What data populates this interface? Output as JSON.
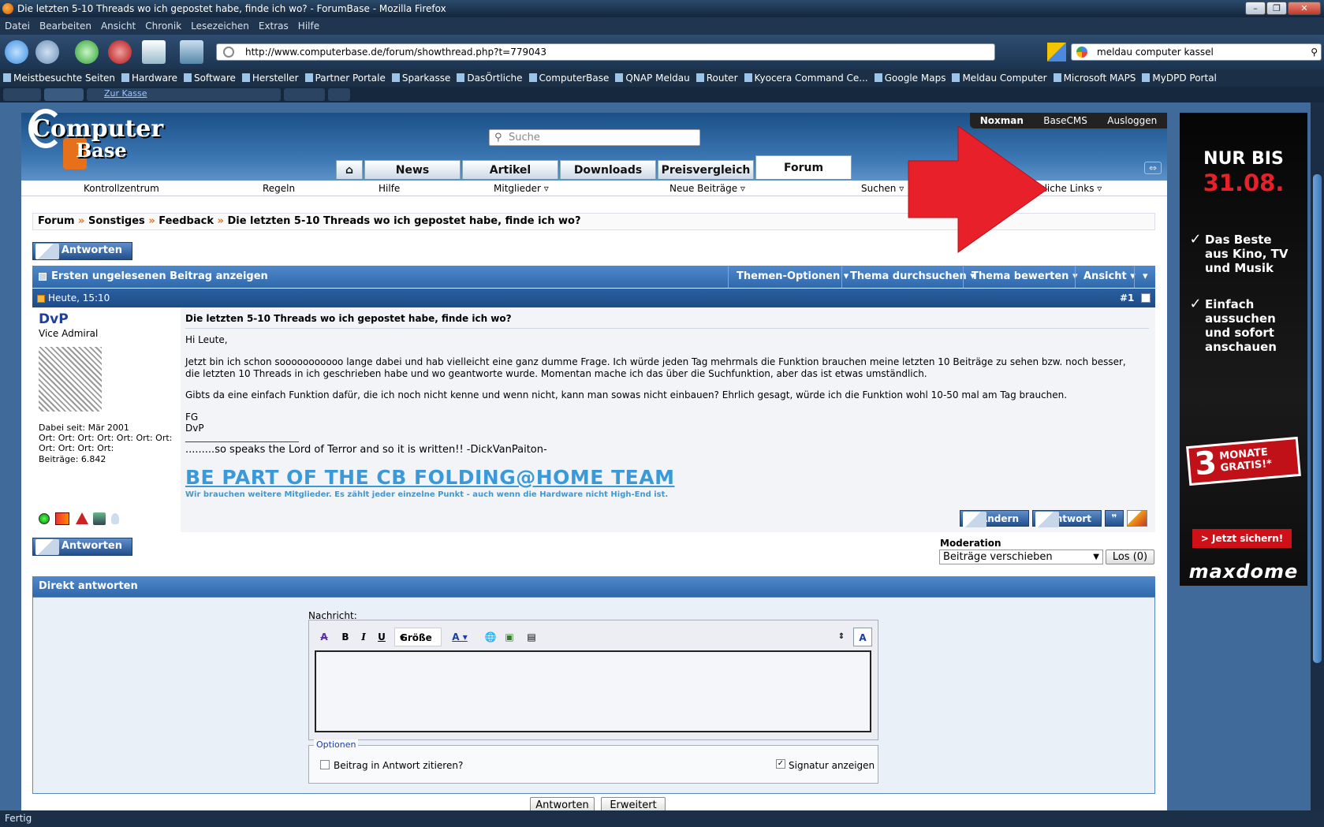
{
  "window": {
    "title": "Die letzten 5-10 Threads wo ich gepostet habe, finde ich wo? - ForumBase - Mozilla Firefox"
  },
  "menu": [
    "Datei",
    "Bearbeiten",
    "Ansicht",
    "Chronik",
    "Lesezeichen",
    "Extras",
    "Hilfe"
  ],
  "url": "http://www.computerbase.de/forum/showthread.php?t=779043",
  "browser_search": "meldau computer kassel",
  "bookmarks": [
    "Meistbesuchte Seiten",
    "Hardware",
    "Software",
    "Hersteller",
    "Partner Portale",
    "Sparkasse",
    "DasÖrtliche",
    "ComputerBase",
    "QNAP Meldau",
    "Router",
    "Kyocera Command Ce...",
    "Google Maps",
    "Meldau Computer",
    "Microsoft MAPS",
    "MyDPD Portal"
  ],
  "tab_link": "Zur Kasse",
  "site": {
    "logo_line1": "Computer",
    "logo_line2": "Base",
    "search_placeholder": "Suche",
    "user": [
      "Noxman",
      "BaseCMS",
      "Ausloggen"
    ],
    "tabs": [
      "News",
      "Artikel",
      "Downloads",
      "Preisvergleich",
      "Forum"
    ],
    "subnav": [
      "Kontrollzentrum",
      "Regeln",
      "Hilfe",
      "Mitglieder ▿",
      "Neue Beiträge ▿",
      "Suchen ▿",
      "Nützliche Links ▿"
    ]
  },
  "breadcrumb": [
    "Forum",
    "Sonstiges",
    "Feedback",
    "Die letzten 5-10 Threads wo ich gepostet habe, finde ich wo?"
  ],
  "breadcrumb_sep": "»",
  "reply_button": "Antworten",
  "threadbar": {
    "first_unread": "Ersten ungelesenen Beitrag anzeigen",
    "options": [
      "Themen-Optionen ▾",
      "Thema durchsuchen ▾",
      "Thema bewerten ▾",
      "Ansicht ▾",
      "▾"
    ]
  },
  "post": {
    "date": "Heute, 15:10",
    "number": "#1",
    "username": "DvP",
    "rank": "Vice Admiral",
    "joined": "Dabei seit: Mär 2001",
    "location": "Ort: Ort: Ort: Ort: Ort: Ort: Ort: Ort: Ort: Ort: Ort:",
    "posts": "Beiträge: 6.842",
    "title": "Die letzten 5-10 Threads wo ich gepostet habe, finde ich wo?",
    "greeting": "Hi Leute,",
    "para1": "Jetzt bin ich schon sooooooooooo lange dabei und hab vielleicht eine ganz dumme Frage. Ich würde jeden Tag mehrmals die Funktion brauchen meine letzten 10 Beiträge zu sehen bzw. noch besser, die letzten 10 Threads in ich geschrieben habe und wo geantworte wurde. Momentan mache ich das über die Suchfunktion, aber das ist etwas umständlich.",
    "para2": "Gibts da eine einfach Funktion dafür, die ich noch nicht kenne und wenn nicht, kann man sowas nicht einbauen? Ehrlich gesagt, würde ich die Funktion wohl 10-50 mal am Tag brauchen.",
    "sign1": "FG",
    "sign2": "DvP",
    "sig_quote": ".........so speaks the Lord of Terror and so it is written!! -DickVanPaiton-",
    "sig_banner": "BE PART OF THE CB FOLDING@HOME TEAM",
    "sig_sub": "Wir brauchen weitere Mitglieder. Es zählt jeder einzelne Punkt - auch wenn die Hardware nicht High-End ist.",
    "btn_edit": "Ändern",
    "btn_reply": "Antwort"
  },
  "moderation": {
    "label": "Moderation",
    "selected": "Beiträge verschieben",
    "go": "Los (0)"
  },
  "quick_reply": {
    "title": "Direkt antworten",
    "message_label": "Nachricht:",
    "size_label": "Größe",
    "options_legend": "Optionen",
    "quote_label": "Beitrag in Antwort zitieren?",
    "sig_label": "Signatur anzeigen",
    "submit": "Antworten",
    "advanced": "Erweitert"
  },
  "ad": {
    "line1": "NUR BIS",
    "line2": "31.08.",
    "bullet1": "Das Beste aus Kino, TV und Musik",
    "bullet2": "Einfach aussuchen und sofort anschauen",
    "badge_big": "3",
    "badge_small": "MONATE GRATIS!*",
    "cta": "> Jetzt sichern!",
    "brand": "maxdome"
  },
  "status": "Fertig",
  "colors": {
    "accent": "#2f68ab",
    "arrow": "#e8202a",
    "banner": "#3a9ad9"
  }
}
